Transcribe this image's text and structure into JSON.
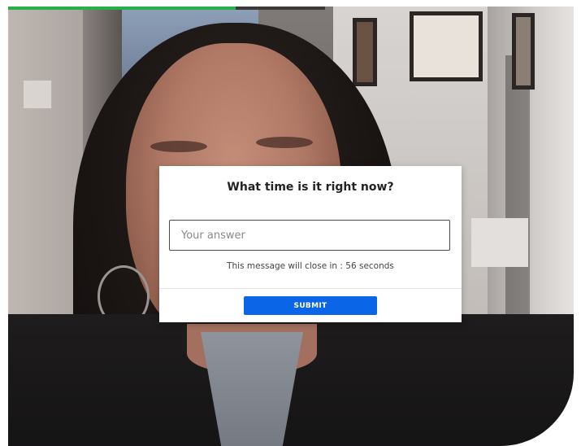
{
  "video": {
    "progress_color": "#27b04a"
  },
  "dialog": {
    "title": "What time is it right now?",
    "answer_placeholder": "Your answer",
    "answer_value": "",
    "countdown_text": "This message will close in : 56 seconds",
    "submit_label": "SUBMIT",
    "submit_color": "#0a66e6"
  }
}
